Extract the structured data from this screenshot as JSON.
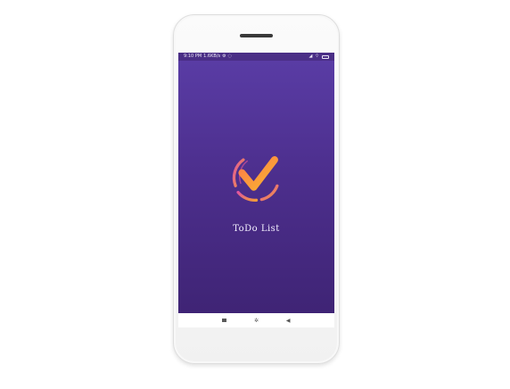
{
  "status_bar": {
    "time": "9:10 PM",
    "speed": "1.6KB/s",
    "left_icons": [
      "settings-icon",
      "sync-icon"
    ],
    "right_icons": [
      "signal-icon",
      "wifi-icon",
      "battery-icon"
    ]
  },
  "splash": {
    "app_name": "ToDo List",
    "logo_icon": "checkmark-ring-icon"
  },
  "nav_bar": {
    "buttons": [
      "recents-button",
      "home-button",
      "back-button"
    ]
  },
  "colors": {
    "screen_top": "#5a3da6",
    "screen_bottom": "#3f2475",
    "check_gradient_start": "#ff8a4c",
    "check_gradient_end": "#f5b52e",
    "ring_pink": "#e0559f",
    "ring_orange": "#f39a3a",
    "text": "#f4f0ff"
  }
}
